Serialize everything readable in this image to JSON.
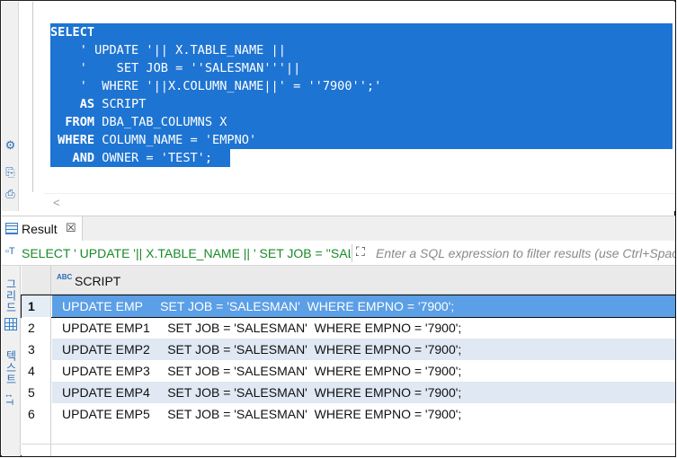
{
  "editor": {
    "lines": [
      {
        "kw": "SELECT",
        "rest": ""
      },
      {
        "kw": "",
        "rest": "    ' UPDATE '|| X.TABLE_NAME ||"
      },
      {
        "kw": "",
        "rest": "    '    SET JOB = ''SALESMAN'''||"
      },
      {
        "kw": "",
        "rest": "    '  WHERE '||X.COLUMN_NAME||' = ''7900'';'"
      },
      {
        "kw": "    AS",
        "rest": " SCRIPT"
      },
      {
        "kw": "  FROM",
        "rest": " DBA_TAB_COLUMNS X"
      },
      {
        "kw": " WHERE",
        "rest": " COLUMN_NAME = 'EMPNO'"
      },
      {
        "kw": "   AND",
        "rest": " OWNER = 'TEST';"
      }
    ],
    "selection_color": "#1e74d2"
  },
  "result_tab": {
    "label": "Result",
    "close": "☒"
  },
  "filter": {
    "sql_text": "SELECT ' UPDATE '|| X.TABLE_NAME || ' SET JOB = ''SALESMAN'''|| ' WHERE '||X.COLUMN_NAME||' = ''7900'';'",
    "placeholder": "Enter a SQL expression to filter results (use Ctrl+Space)"
  },
  "sidebar": {
    "grid_label": "그리드",
    "text_label": "텍스트"
  },
  "grid": {
    "column": "SCRIPT",
    "type_badge": "ABC",
    "rows": [
      {
        "num": "1",
        "value": "UPDATE EMP     SET JOB = 'SALESMAN'  WHERE EMPNO = '7900';"
      },
      {
        "num": "2",
        "value": "UPDATE EMP1     SET JOB = 'SALESMAN'  WHERE EMPNO = '7900';"
      },
      {
        "num": "3",
        "value": "UPDATE EMP2     SET JOB = 'SALESMAN'  WHERE EMPNO = '7900';"
      },
      {
        "num": "4",
        "value": "UPDATE EMP3     SET JOB = 'SALESMAN'  WHERE EMPNO = '7900';"
      },
      {
        "num": "5",
        "value": "UPDATE EMP4     SET JOB = 'SALESMAN'  WHERE EMPNO = '7900';"
      },
      {
        "num": "6",
        "value": "UPDATE EMP5     SET JOB = 'SALESMAN'  WHERE EMPNO = '7900';"
      }
    ]
  }
}
